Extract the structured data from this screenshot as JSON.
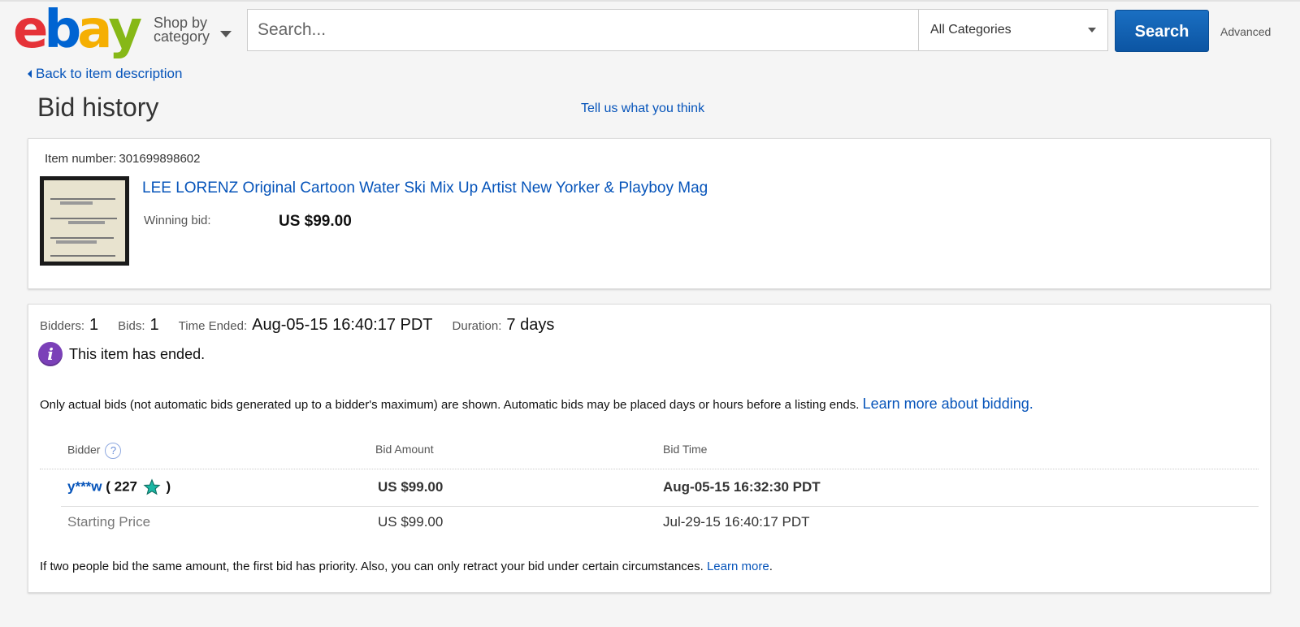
{
  "header": {
    "logo": {
      "letters": [
        "e",
        "b",
        "a",
        "y"
      ],
      "colors": [
        "#e53238",
        "#0064d2",
        "#f5af02",
        "#86b817"
      ]
    },
    "shop_by_line1": "Shop by",
    "shop_by_line2": "category",
    "search_placeholder": "Search...",
    "category_selected": "All Categories",
    "search_button": "Search",
    "advanced_link": "Advanced"
  },
  "nav": {
    "back_link": "Back to item description"
  },
  "page": {
    "title": "Bid history",
    "feedback_link": "Tell us what you think"
  },
  "item": {
    "number_label": "Item number:",
    "number": "301699898602",
    "title": "LEE LORENZ Original Cartoon Water Ski Mix Up Artist New Yorker & Playboy Mag",
    "winning_bid_label": "Winning bid:",
    "winning_bid": "US $99.00"
  },
  "summary": {
    "bidders_label": "Bidders:",
    "bidders": "1",
    "bids_label": "Bids:",
    "bids": "1",
    "time_ended_label": "Time Ended:",
    "time_ended": "Aug-05-15 16:40:17 PDT",
    "duration_label": "Duration:",
    "duration": "7 days",
    "status": "This item has ended."
  },
  "notice": {
    "text": "Only actual bids (not automatic bids generated up to a bidder's maximum) are shown. Automatic bids may be placed days or hours before a listing ends. ",
    "link": "Learn more about bidding",
    "suffix": "."
  },
  "bid_table": {
    "headers": {
      "bidder": "Bidder",
      "amount": "Bid Amount",
      "time": "Bid Time"
    },
    "rows": [
      {
        "bidder": "y***w",
        "feedback_open": "( 227",
        "feedback_close": ")",
        "amount": "US $99.00",
        "time": "Aug-05-15 16:32:30 PDT",
        "star_color": "#1bb7a4"
      }
    ],
    "starting": {
      "label": "Starting Price",
      "amount": "US $99.00",
      "time": "Jul-29-15 16:40:17 PDT"
    }
  },
  "footer": {
    "text": "If two people bid the same amount, the first bid has priority. Also, you can only retract your bid under certain circumstances. ",
    "link": "Learn more",
    "suffix": "."
  }
}
